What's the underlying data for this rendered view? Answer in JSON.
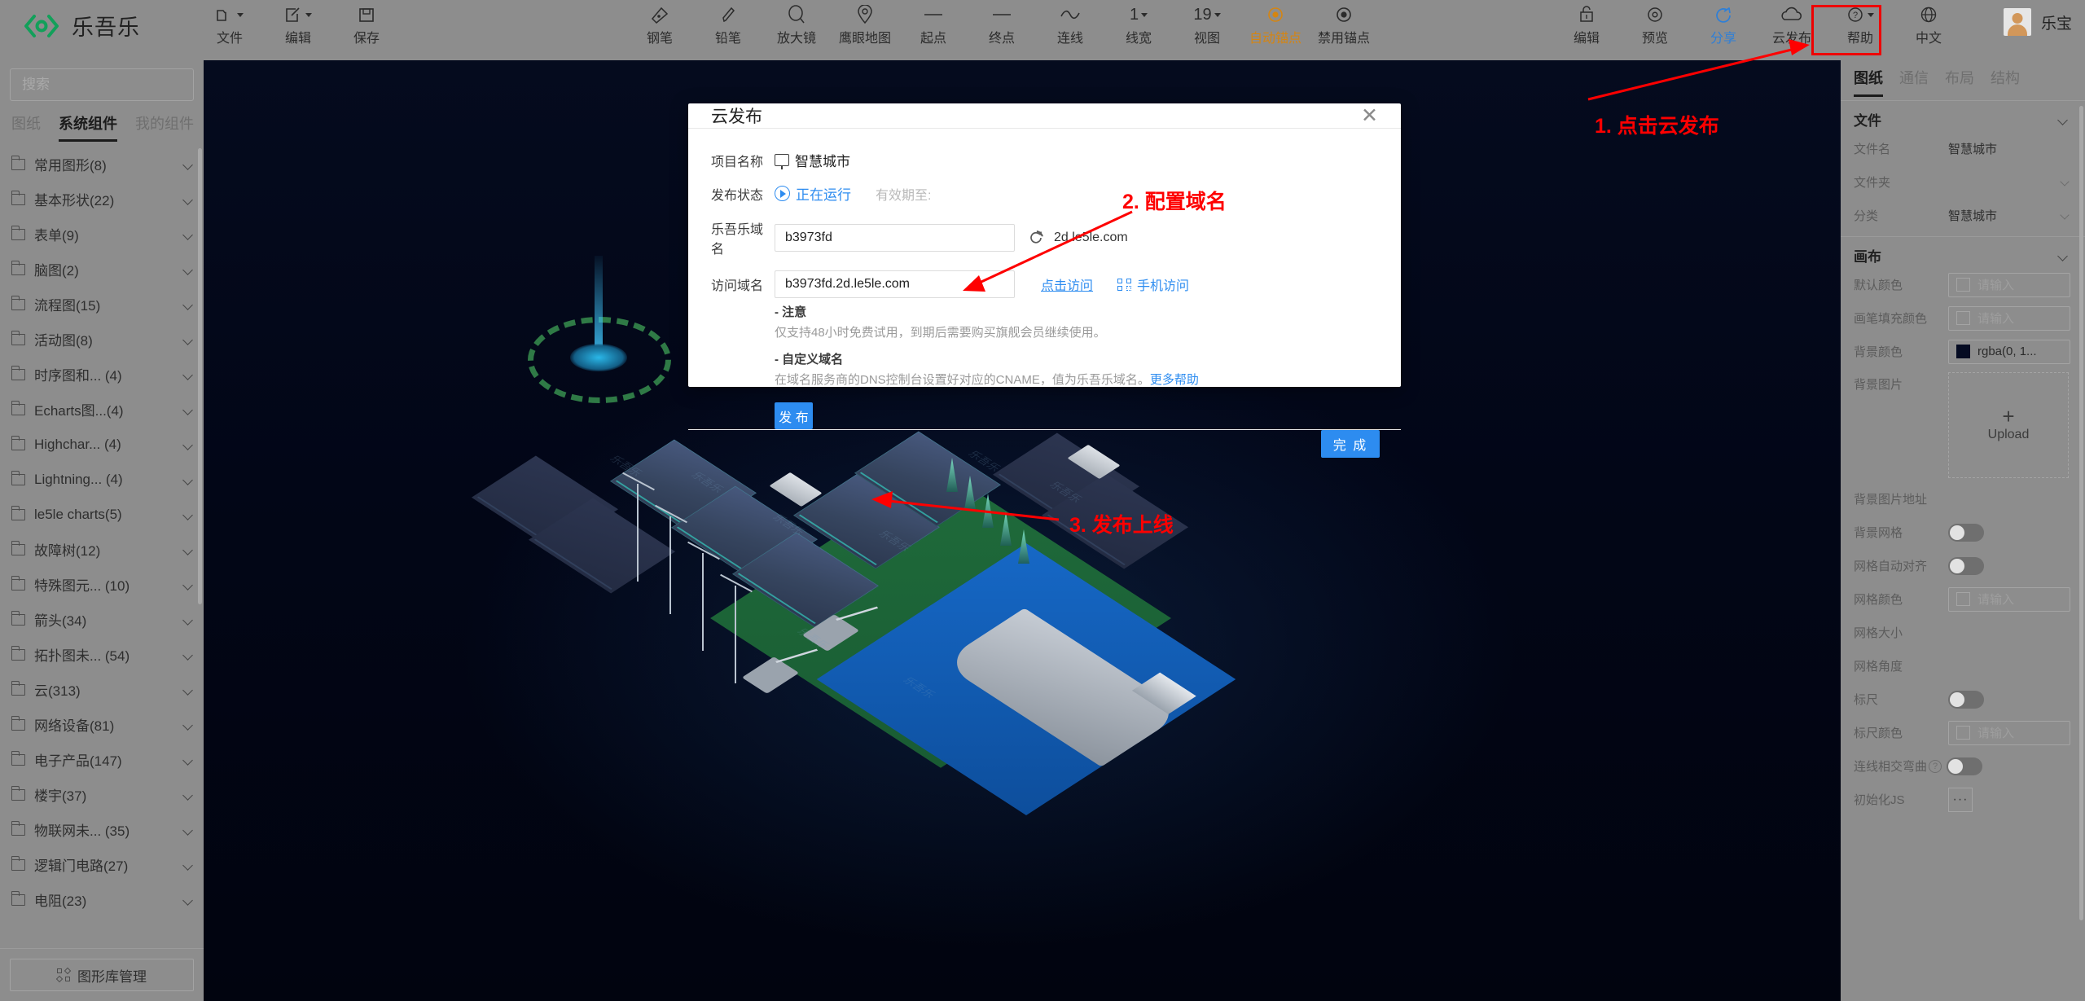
{
  "app": {
    "brand": "乐吾乐",
    "user_name": "乐宝"
  },
  "toolbar": {
    "left_tools": [
      {
        "label": "文件",
        "icon": "folder-icon",
        "caret": true
      },
      {
        "label": "编辑",
        "icon": "edit-pencil-icon",
        "caret": true
      },
      {
        "label": "保存",
        "icon": "save-disk-icon",
        "caret": false
      }
    ],
    "center_tools": [
      {
        "label": "钢笔",
        "icon": "pen-nib-icon",
        "caret": false,
        "accent": false
      },
      {
        "label": "铅笔",
        "icon": "pencil-icon",
        "caret": false,
        "accent": false
      },
      {
        "label": "放大镜",
        "icon": "magnifier-icon",
        "caret": false,
        "accent": false
      },
      {
        "label": "鹰眼地图",
        "icon": "eagle-eye-map-icon",
        "caret": false,
        "accent": false
      },
      {
        "label": "起点",
        "icon": "line-start-icon",
        "caret": false,
        "accent": false
      },
      {
        "label": "终点",
        "icon": "line-end-icon",
        "caret": false,
        "accent": false
      },
      {
        "label": "连线",
        "icon": "curve-line-icon",
        "caret": false,
        "accent": false
      },
      {
        "label": "线宽",
        "icon": "text-1",
        "text": "1",
        "caret": true,
        "accent": false
      },
      {
        "label": "视图",
        "icon": "text-19",
        "text": "19",
        "caret": true,
        "accent": false
      },
      {
        "label": "自动锚点",
        "icon": "anchor-auto-icon",
        "caret": false,
        "accent": true
      },
      {
        "label": "禁用锚点",
        "icon": "anchor-disable-icon",
        "caret": false,
        "accent": false
      }
    ],
    "right_tools": [
      {
        "label": "编辑",
        "icon": "lock-edit-icon",
        "caret": false,
        "blue": false
      },
      {
        "label": "预览",
        "icon": "preview-eye-icon",
        "caret": false,
        "blue": false
      },
      {
        "label": "分享",
        "icon": "share-icon",
        "caret": false,
        "blue": true
      },
      {
        "label": "云发布",
        "icon": "cloud-publish-icon",
        "caret": false,
        "blue": false
      },
      {
        "label": "帮助",
        "icon": "help-question-icon",
        "caret": true,
        "blue": false
      },
      {
        "label": "中文",
        "icon": "globe-language-icon",
        "caret": false,
        "blue": false
      }
    ]
  },
  "left_panel": {
    "search_placeholder": "搜索",
    "tabs": [
      {
        "label": "图纸",
        "active": false
      },
      {
        "label": "系统组件",
        "active": true
      },
      {
        "label": "我的组件",
        "active": false
      }
    ],
    "categories": [
      {
        "label": "常用图形(8)"
      },
      {
        "label": "基本形状(22)"
      },
      {
        "label": "表单(9)"
      },
      {
        "label": "脑图(2)"
      },
      {
        "label": "流程图(15)"
      },
      {
        "label": "活动图(8)"
      },
      {
        "label": "时序图和... (4)"
      },
      {
        "label": "Echarts图...(4)"
      },
      {
        "label": "Highchar... (4)"
      },
      {
        "label": "Lightning... (4)"
      },
      {
        "label": "le5le charts(5)"
      },
      {
        "label": "故障树(12)"
      },
      {
        "label": "特殊图元... (10)"
      },
      {
        "label": "箭头(34)"
      },
      {
        "label": "拓扑图未... (54)"
      },
      {
        "label": "云(313)"
      },
      {
        "label": "网络设备(81)"
      },
      {
        "label": "电子产品(147)"
      },
      {
        "label": "楼宇(37)"
      },
      {
        "label": "物联网未... (35)"
      },
      {
        "label": "逻辑门电路(27)"
      },
      {
        "label": "电阻(23)"
      }
    ],
    "library_button": "图形库管理"
  },
  "right_panel": {
    "tabs": [
      {
        "label": "图纸",
        "active": true
      },
      {
        "label": "通信",
        "active": false
      },
      {
        "label": "布局",
        "active": false
      },
      {
        "label": "结构",
        "active": false
      }
    ],
    "file_section": {
      "title": "文件",
      "rows": [
        {
          "key": "文件名",
          "value": "智慧城市",
          "type": "text"
        },
        {
          "key": "文件夹",
          "value": "",
          "type": "select"
        },
        {
          "key": "分类",
          "value": "智慧城市",
          "type": "select"
        }
      ]
    },
    "canvas_section": {
      "title": "画布",
      "rows": [
        {
          "key": "默认颜色",
          "placeholder": "请输入",
          "type": "color"
        },
        {
          "key": "画笔填充颜色",
          "placeholder": "请输入",
          "type": "color"
        },
        {
          "key": "背景颜色",
          "value": "rgba(0, 1...",
          "type": "color-filled",
          "swatch": "#050b22"
        },
        {
          "key": "背景图片",
          "type": "upload",
          "upload_label": "Upload",
          "upload_plus": "+"
        },
        {
          "key": "背景图片地址",
          "type": "plain"
        },
        {
          "key": "背景网格",
          "type": "toggle",
          "on": false
        },
        {
          "key": "网格自动对齐",
          "type": "toggle",
          "on": false
        },
        {
          "key": "网格颜色",
          "placeholder": "请输入",
          "type": "color"
        },
        {
          "key": "网格大小",
          "type": "plain"
        },
        {
          "key": "网格角度",
          "type": "plain"
        },
        {
          "key": "标尺",
          "type": "toggle",
          "on": false
        },
        {
          "key": "标尺颜色",
          "placeholder": "请输入",
          "type": "color"
        },
        {
          "key": "连线相交弯曲",
          "type": "toggle-help",
          "on": false
        },
        {
          "key": "初始化JS",
          "type": "dots",
          "dots": "···"
        }
      ]
    }
  },
  "modal": {
    "title": "云发布",
    "close": "✕",
    "project_label": "项目名称",
    "project_name": "智慧城市",
    "status_label": "发布状态",
    "status_value": "正在运行",
    "expire_label": "有效期至:",
    "domain_label": "乐吾乐域名",
    "domain_value": "b3973fd",
    "domain_suffix": "2d.le5le.com",
    "access_label": "访问域名",
    "access_value": "b3973fd.2d.le5le.com",
    "visit_link": "点击访问",
    "mobile_link": "手机访问",
    "note_title": "- 注意",
    "note_text": "仅支持48小时免费试用，到期后需要购买旗舰会员继续使用。",
    "custom_title": "- 自定义域名",
    "custom_text": "在域名服务商的DNS控制台设置好对应的CNAME，值为乐吾乐域名。",
    "more_help": "更多帮助",
    "publish_button": "发 布",
    "done_button": "完 成"
  },
  "annotations": [
    {
      "text": "1. 点击云发布"
    },
    {
      "text": "2. 配置域名"
    },
    {
      "text": "3. 发布上线"
    }
  ],
  "colors": {
    "accent_orange": "#d58512",
    "link_blue": "#2d8cf0",
    "annotation_red": "#fe0000",
    "toolbar_gray": "#8d8d8d",
    "canvas_dark": "#020719"
  }
}
